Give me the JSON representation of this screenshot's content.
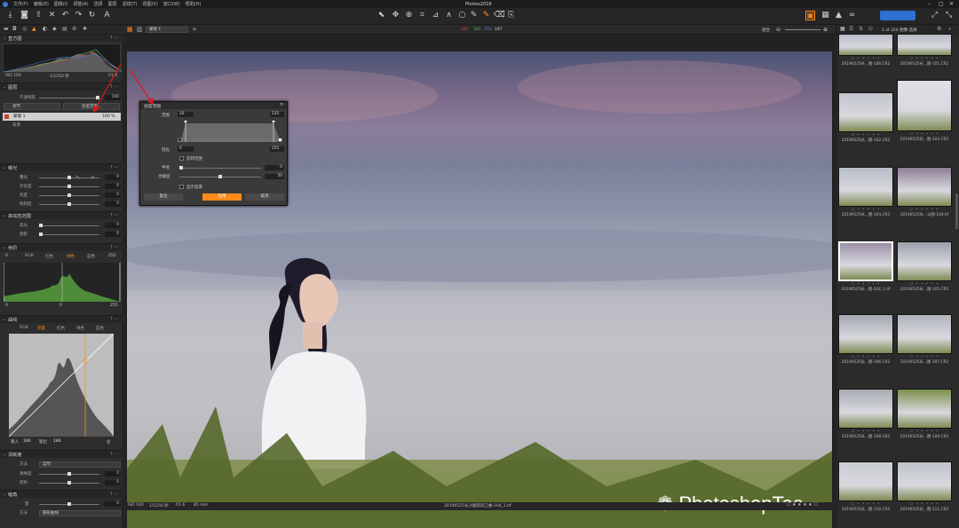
{
  "app": {
    "title": "Photos2019"
  },
  "menu": [
    "文件(F)",
    "编辑(E)",
    "图像(I)",
    "调整(A)",
    "选择",
    "图层",
    "滤镜(T)",
    "视图(V)",
    "窗口(W)",
    "帮助(H)"
  ],
  "leftpanel": {
    "histogram": {
      "title": "直方图",
      "iso": "ISO 100",
      "shutter": "1/1250 秒",
      "aperture": "f/1.6"
    },
    "layers": {
      "title": "图层",
      "opacity_label": "不透明度",
      "opacity_value": "100",
      "layer_select": "调节",
      "add_button": "亮度范围...",
      "layer_name": "蒙版 1",
      "layer_pct": "100 %",
      "background": "背景"
    },
    "exposure": {
      "title": "曝光",
      "rows": [
        {
          "label": "曝光",
          "value": "0"
        },
        {
          "label": "对比度",
          "value": "0"
        },
        {
          "label": "亮度",
          "value": "0"
        },
        {
          "label": "饱和度",
          "value": "0"
        }
      ]
    },
    "hdr": {
      "title": "高动态范围",
      "rows": [
        {
          "label": "高光",
          "value": "0"
        },
        {
          "label": "阴影",
          "value": "0"
        }
      ]
    },
    "levels": {
      "title": "色阶",
      "tabs": [
        "RGB",
        "红色",
        "绿色",
        "蓝色"
      ],
      "low": "0",
      "mid": "0",
      "high": "255",
      "min": "0",
      "max": "255"
    },
    "curves": {
      "title": "曲线",
      "tabs": [
        "RGB",
        "亮度",
        "红色",
        "绿色",
        "蓝色"
      ],
      "input_label": "输入",
      "input_value": "186",
      "output_label": "输出",
      "output_value": "186"
    },
    "clarity": {
      "title": "清晰度",
      "method_label": "方法",
      "method_value": "自然",
      "rows": [
        {
          "label": "清晰度",
          "value": "0"
        },
        {
          "label": "结构",
          "value": "0"
        }
      ]
    },
    "vignette": {
      "title": "暗角",
      "rows": [
        {
          "label": "量",
          "value": "0"
        }
      ],
      "method_label": "方法",
      "method_value": "圆形曲线"
    }
  },
  "center": {
    "layer_select": "蒙版 1",
    "rgb": {
      "r": "197",
      "g": "181",
      "b": "193",
      "l": "187"
    },
    "fit_label": "适合",
    "status": {
      "iso": "ISO 100",
      "shutter": "1/1250 秒",
      "aperture": "f/1.6",
      "focal": "85 mm",
      "filename": "20190525长沙烟雨滨江曲-104_1.tif"
    },
    "watermark": "PhotoshopTea"
  },
  "dialog": {
    "title": "亮度范围",
    "range_label": "范围",
    "range_low": "20",
    "range_high": "235",
    "falloff_label": "羽化",
    "falloff_low": "0",
    "falloff_high": "255",
    "invert_label": "反转范围",
    "radius_label": "半径",
    "radius_value": "0",
    "sensitivity_label": "灵敏度",
    "sensitivity_value": "50",
    "show_mask_label": "显示遮罩",
    "reset_button": "复位",
    "apply_button": "应用",
    "cancel_button": "取消"
  },
  "rightpanel": {
    "count_text": "1 of 324 图像 选择",
    "thumbs": [
      {
        "cap": "20190525长...图-106.CR2"
      },
      {
        "cap": "20190525长...图-101.CR2"
      },
      {
        "cap": "20190525长...图-102.CR2"
      },
      {
        "cap": "20190525长...图-103.CR2"
      },
      {
        "cap": "20190525长...图-104.CR2"
      },
      {
        "cap": "20190525长...公图-104.tif"
      },
      {
        "cap": "20190525长...图-104_1.tif"
      },
      {
        "cap": "20190525长...图-105.CR2"
      },
      {
        "cap": "20190525长...图-106.CR2"
      },
      {
        "cap": "20190525长...图-107.CR2"
      },
      {
        "cap": "20190525长...图-108.CR2"
      },
      {
        "cap": "20190525长...图-109.CR2"
      },
      {
        "cap": "20190525长...图-110.CR2"
      },
      {
        "cap": "20190525长...图-111.CR2"
      }
    ]
  }
}
